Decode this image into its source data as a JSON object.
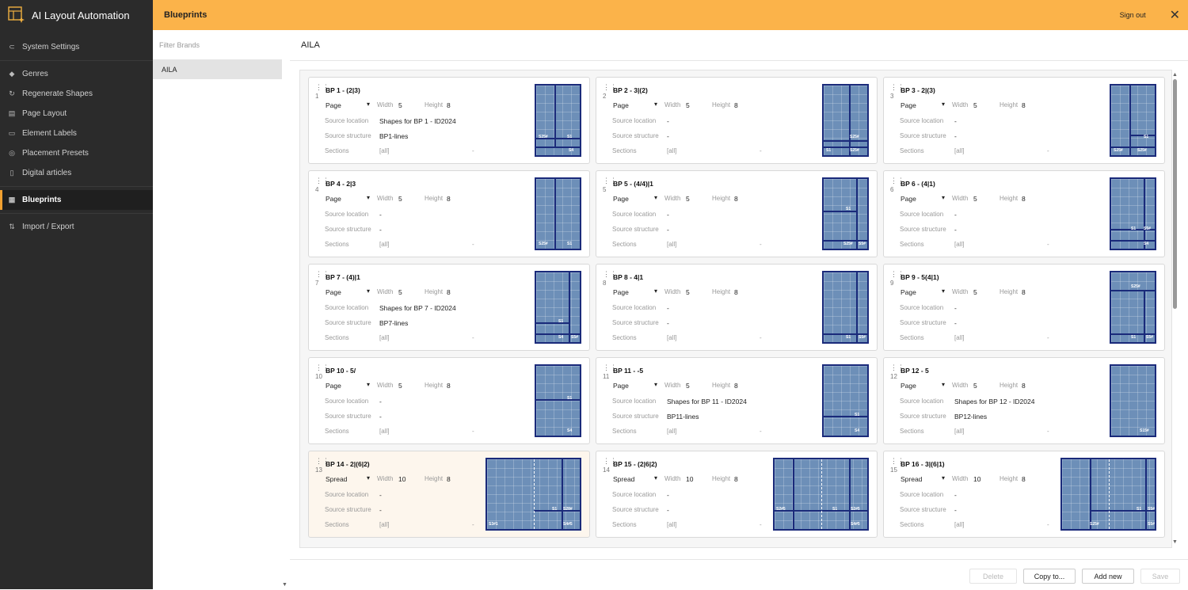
{
  "app": {
    "title": "AI Layout Automation"
  },
  "topbar": {
    "title": "Blueprints",
    "signout": "Sign out"
  },
  "sidebar": {
    "items": [
      {
        "label": "System Settings",
        "icon": "toggle-icon"
      },
      {
        "label": "Genres",
        "icon": "tag-icon"
      },
      {
        "label": "Regenerate Shapes",
        "icon": "refresh-icon"
      },
      {
        "label": "Page Layout",
        "icon": "page-icon"
      },
      {
        "label": "Element Labels",
        "icon": "label-icon"
      },
      {
        "label": "Placement Presets",
        "icon": "target-icon"
      },
      {
        "label": "Digital articles",
        "icon": "document-icon"
      },
      {
        "label": "Blueprints",
        "icon": "blueprint-icon",
        "active": true
      },
      {
        "label": "Import / Export",
        "icon": "import-export-icon"
      }
    ]
  },
  "brands": {
    "filter_placeholder": "Filter Brands",
    "items": [
      "AILA"
    ]
  },
  "main": {
    "title": "AILA"
  },
  "labels": {
    "width": "Width",
    "height": "Height",
    "source_location": "Source location",
    "source_structure": "Source structure",
    "sections": "Sections"
  },
  "blueprints": [
    {
      "idx": "1",
      "name": "BP 1 - (2|3)",
      "type": "Page",
      "width": "5",
      "height": "8",
      "source_location": "Shapes for BP 1 - ID2024",
      "source_structure": "BP1-lines",
      "sections": "[all]",
      "sections_right": "-",
      "tags": [
        "S25#",
        "S1",
        "S4"
      ]
    },
    {
      "idx": "2",
      "name": "BP 2 - 3|(2)",
      "type": "Page",
      "width": "5",
      "height": "8",
      "source_location": "-",
      "source_structure": "-",
      "sections": "[all]",
      "sections_right": "-",
      "tags": [
        "S25#",
        "S1",
        "S25#"
      ]
    },
    {
      "idx": "3",
      "name": "BP 3 - 2|(3)",
      "type": "Page",
      "width": "5",
      "height": "8",
      "source_location": "-",
      "source_structure": "-",
      "sections": "[all]",
      "sections_right": "-",
      "tags": [
        "S1",
        "S25#",
        "S25#"
      ]
    },
    {
      "idx": "4",
      "name": "BP 4 - 2|3",
      "type": "Page",
      "width": "5",
      "height": "8",
      "source_location": "-",
      "source_structure": "-",
      "sections": "[all]",
      "sections_right": "-",
      "tags": [
        "S25#",
        "S1"
      ]
    },
    {
      "idx": "5",
      "name": "BP 5 - (4/4)|1",
      "type": "Page",
      "width": "5",
      "height": "8",
      "source_location": "-",
      "source_structure": "-",
      "sections": "[all]",
      "sections_right": "-",
      "tags": [
        "S1",
        "S25#",
        "S5#"
      ]
    },
    {
      "idx": "6",
      "name": "BP 6 - (4|1)",
      "type": "Page",
      "width": "5",
      "height": "8",
      "source_location": "-",
      "source_structure": "-",
      "sections": "[all]",
      "sections_right": "-",
      "tags": [
        "S1",
        "S5#",
        "S4"
      ]
    },
    {
      "idx": "7",
      "name": "BP 7 - (4)|1",
      "type": "Page",
      "width": "5",
      "height": "8",
      "source_location": "Shapes for BP 7 - ID2024",
      "source_structure": "BP7-lines",
      "sections": "[all]",
      "sections_right": "-",
      "tags": [
        "S1",
        "S4",
        "S5#"
      ]
    },
    {
      "idx": "8",
      "name": "BP 8 - 4|1",
      "type": "Page",
      "width": "5",
      "height": "8",
      "source_location": "-",
      "source_structure": "-",
      "sections": "[all]",
      "sections_right": "-",
      "tags": [
        "S1",
        "S5#"
      ]
    },
    {
      "idx": "9",
      "name": "BP 9 - 5(4|1)",
      "type": "Page",
      "width": "5",
      "height": "8",
      "source_location": "-",
      "source_structure": "-",
      "sections": "[all]",
      "sections_right": "-",
      "tags": [
        "S25#",
        "S1",
        "S5#"
      ]
    },
    {
      "idx": "10",
      "name": "BP 10 - 5/",
      "type": "Page",
      "width": "5",
      "height": "8",
      "source_location": "-",
      "source_structure": "-",
      "sections": "[all]",
      "sections_right": "-",
      "tags": [
        "S1",
        "S4"
      ]
    },
    {
      "idx": "11",
      "name": "BP 11 - -5",
      "type": "Page",
      "width": "5",
      "height": "8",
      "source_location": "Shapes for BP 11 - ID2024",
      "source_structure": "BP11-lines",
      "sections": "[all]",
      "sections_right": "-",
      "tags": [
        "S1",
        "S4"
      ]
    },
    {
      "idx": "12",
      "name": "BP 12 - 5",
      "type": "Page",
      "width": "5",
      "height": "8",
      "source_location": "Shapes for BP 12 - ID2024",
      "source_structure": "BP12-lines",
      "sections": "[all]",
      "sections_right": "-",
      "tags": [
        "S15#"
      ]
    },
    {
      "idx": "13",
      "name": "BP 14 - 2|(6|2)",
      "type": "Spread",
      "width": "10",
      "height": "8",
      "source_location": "-",
      "source_structure": "-",
      "sections": "[all]",
      "sections_right": "-",
      "tags": [
        "S1",
        "S28#",
        "S3#1",
        "S4#5"
      ]
    },
    {
      "idx": "14",
      "name": "BP 15 - (2|6|2)",
      "type": "Spread",
      "width": "10",
      "height": "8",
      "source_location": "-",
      "source_structure": "-",
      "sections": "[all]",
      "sections_right": "-",
      "tags": [
        "S2#5",
        "S1",
        "S2#5",
        "S4#5"
      ]
    },
    {
      "idx": "15",
      "name": "BP 16 - 3|(6|1)",
      "type": "Spread",
      "width": "10",
      "height": "8",
      "source_location": "-",
      "source_structure": "-",
      "sections": "[all]",
      "sections_right": "-",
      "tags": [
        "S1",
        "S5#",
        "S25#",
        "S5#"
      ]
    }
  ],
  "footer": {
    "delete": "Delete",
    "copy": "Copy to...",
    "add": "Add new",
    "save": "Save"
  }
}
